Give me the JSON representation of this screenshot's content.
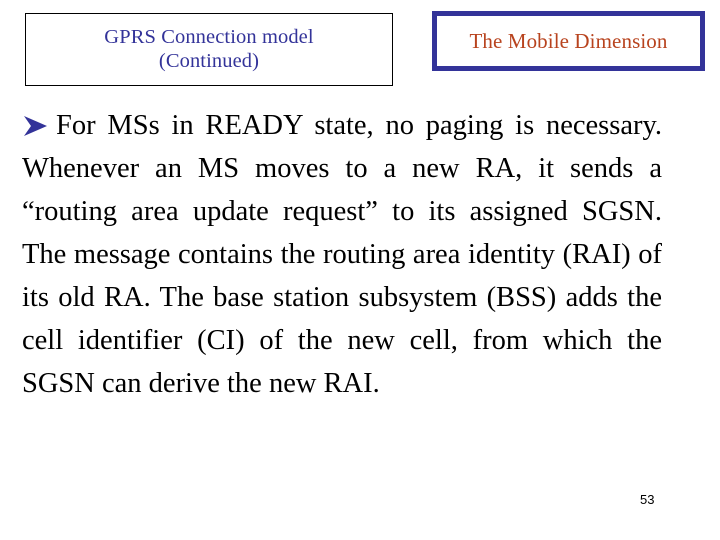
{
  "slide": {
    "title_box": {
      "line1": "GPRS Connection model",
      "line2": "(Continued)",
      "text_color": "#333399",
      "border_color": "#000000"
    },
    "dimension_box": {
      "label": "The Mobile Dimension",
      "text_color": "#b8431e",
      "border_color": "#333399"
    },
    "body": {
      "bullet_icon": "arrow-right-bullet",
      "bullet_color": "#333399",
      "text": "For MSs in READY state, no paging is necessary. Whenever an MS moves to a new RA, it sends a “routing area update request” to its assigned SGSN.   The message contains the routing area identity (RAI) of its old RA. The base station subsystem (BSS) adds the cell identifier (CI) of the new cell, from which the SGSN can derive the new RAI.",
      "text_color": "#000000"
    },
    "page_number": "53"
  }
}
